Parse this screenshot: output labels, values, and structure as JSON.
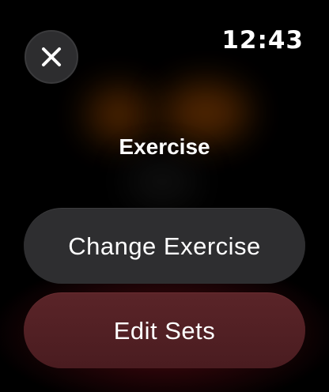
{
  "status_bar": {
    "time": "12:43"
  },
  "header": {
    "close_icon": "close-icon"
  },
  "main": {
    "title": "Exercise"
  },
  "actions": {
    "change_exercise_label": "Change Exercise",
    "edit_sets_label": "Edit Sets"
  },
  "colors": {
    "background": "#000000",
    "pill_neutral": "#2e2e30",
    "pill_accent": "#4a1c20",
    "glow": "#5a2a00"
  }
}
